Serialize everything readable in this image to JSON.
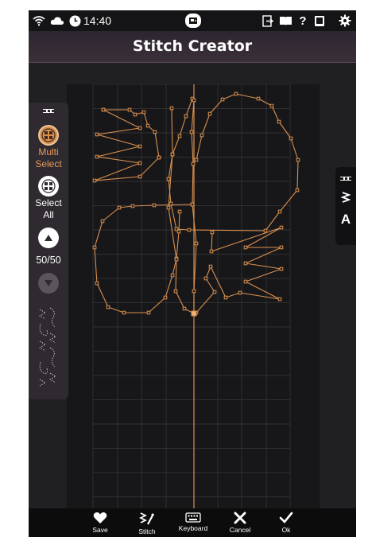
{
  "status_bar": {
    "time": "14:40",
    "icons": [
      "wifi-icon",
      "cloud-icon",
      "clock-icon",
      "embroidery-unit-icon",
      "exit-icon",
      "book-icon",
      "help-icon",
      "tablet-icon",
      "gear-icon"
    ]
  },
  "header": {
    "title": "Stitch Creator"
  },
  "left_panel": {
    "multi_select_label_1": "Multi",
    "multi_select_label_2": "Select",
    "select_all_label_1": "Select",
    "select_all_label_2": "All",
    "point_counter": "50/50",
    "icons": [
      "multi-select-icon",
      "select-all-icon",
      "arrow-up-icon",
      "arrow-down-icon",
      "stitch-preview-icon"
    ]
  },
  "right_panel": {
    "text_icon_label": "A",
    "icons": [
      "zigzag-icon",
      "text-icon"
    ]
  },
  "bottom_bar": {
    "buttons": [
      {
        "label": "Save",
        "icon": "heart-icon"
      },
      {
        "label": "Stitch",
        "icon": "stitch-icon"
      },
      {
        "label": "Keyboard",
        "icon": "keyboard-icon"
      },
      {
        "label": "Cancel",
        "icon": "close-icon"
      },
      {
        "label": "Ok",
        "icon": "checkmark-icon"
      }
    ]
  },
  "colors": {
    "accent": "#e89a58",
    "stitch_line": "#d9904e",
    "background": "#1b1b1d",
    "grid": "#3a3a3c"
  }
}
